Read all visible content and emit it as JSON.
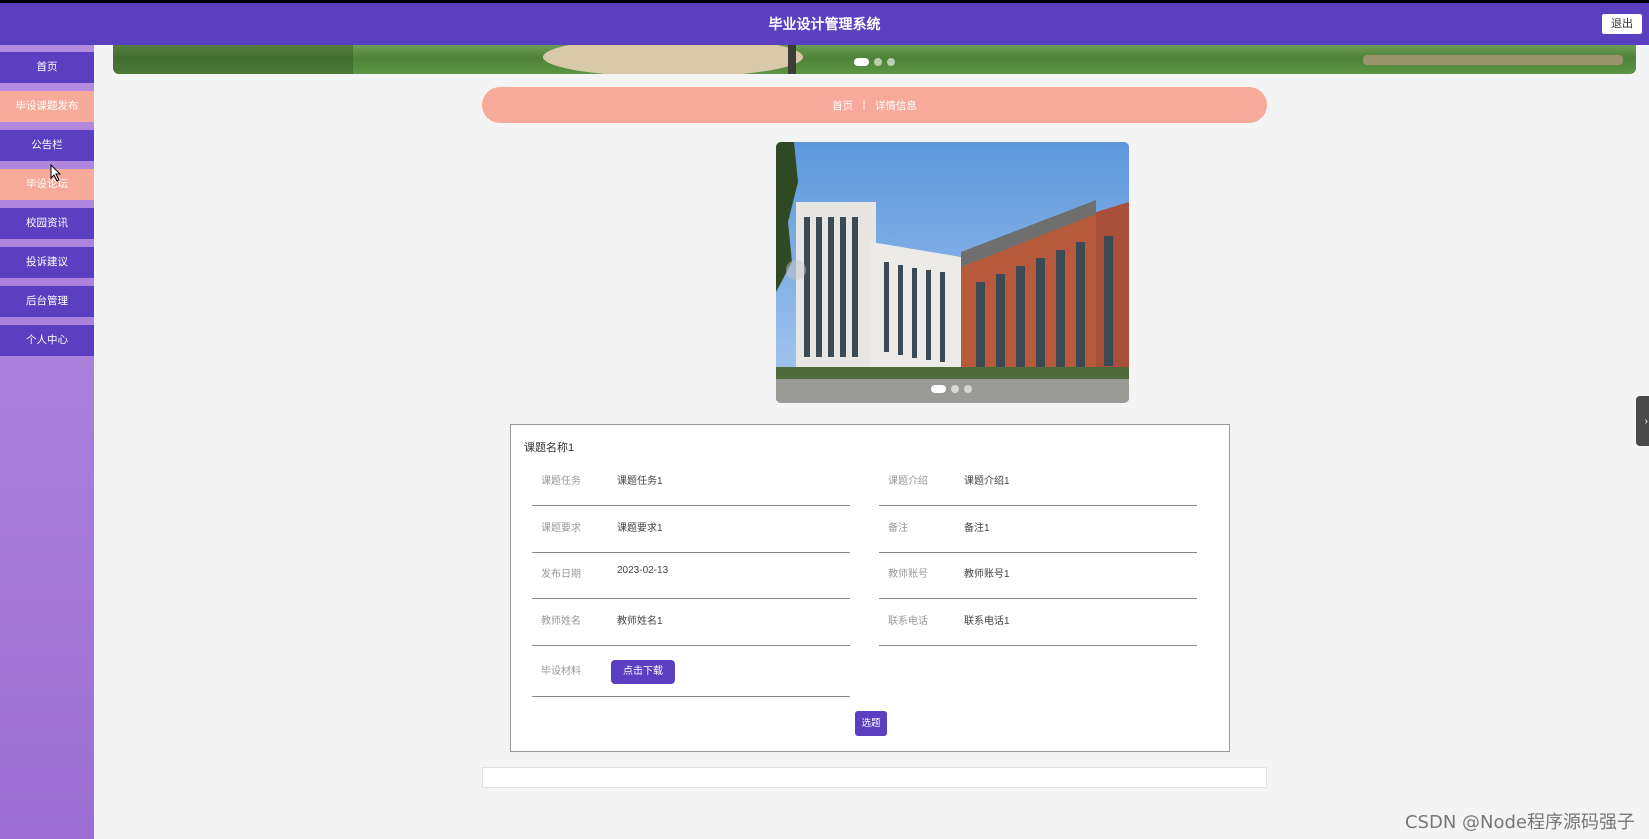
{
  "header": {
    "app_title": "毕业设计管理系统",
    "logout_label": "退出",
    "brand_color": "#5b3fc1"
  },
  "sidebar": {
    "items": [
      {
        "label": "首页"
      },
      {
        "label": "毕设课题发布"
      },
      {
        "label": "公告栏"
      },
      {
        "label": "毕设论坛"
      },
      {
        "label": "校园资讯"
      },
      {
        "label": "投诉建议"
      },
      {
        "label": "后台管理"
      },
      {
        "label": "个人中心"
      }
    ],
    "accent_color": "#f8aa9a"
  },
  "breadcrumb": {
    "home": "首页",
    "separator": "ㅣ",
    "current": "详情信息"
  },
  "detail": {
    "title": "课题名称1",
    "fields": {
      "task": {
        "label": "课题任务",
        "value": "课题任务1"
      },
      "intro": {
        "label": "课题介绍",
        "value": "课题介绍1"
      },
      "requirement": {
        "label": "课题要求",
        "value": "课题要求1"
      },
      "remark": {
        "label": "备注",
        "value": "备注1"
      },
      "publish_date": {
        "label": "发布日期",
        "value": "2023-02-13"
      },
      "teacher_account": {
        "label": "教师账号",
        "value": "教师账号1"
      },
      "teacher_name": {
        "label": "教师姓名",
        "value": "教师姓名1"
      },
      "phone": {
        "label": "联系电话",
        "value": "联系电话1"
      },
      "material": {
        "label": "毕设材料",
        "button": "点击下载"
      }
    },
    "select_button": "选题"
  },
  "watermark": "CSDN @Node程序源码强子"
}
